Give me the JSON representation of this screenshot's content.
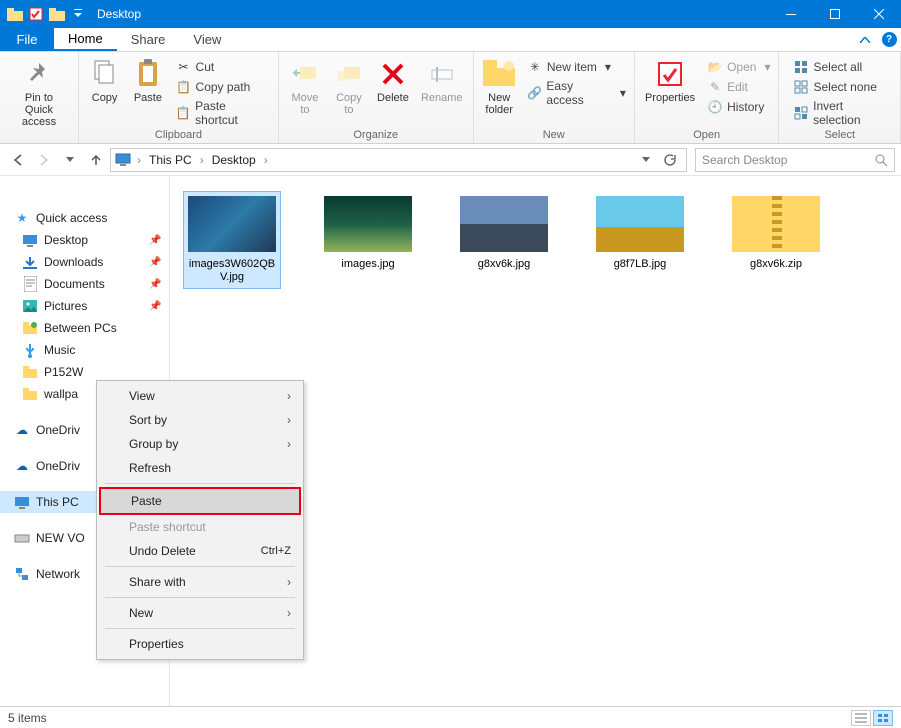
{
  "title": "Desktop",
  "tabs": {
    "file": "File",
    "home": "Home",
    "share": "Share",
    "view": "View"
  },
  "ribbon": {
    "clipboard": {
      "label": "Clipboard",
      "pin": "Pin to Quick\naccess",
      "copy": "Copy",
      "paste": "Paste",
      "cut": "Cut",
      "copypath": "Copy path",
      "pasteshortcut": "Paste shortcut"
    },
    "organize": {
      "label": "Organize",
      "moveto": "Move\nto",
      "copyto": "Copy\nto",
      "delete": "Delete",
      "rename": "Rename"
    },
    "new": {
      "label": "New",
      "newfolder": "New\nfolder",
      "newitem": "New item",
      "easyaccess": "Easy access"
    },
    "open": {
      "label": "Open",
      "properties": "Properties",
      "open": "Open",
      "edit": "Edit",
      "history": "History"
    },
    "select": {
      "label": "Select",
      "selectall": "Select all",
      "selectnone": "Select none",
      "invert": "Invert selection"
    }
  },
  "breadcrumbs": [
    "This PC",
    "Desktop"
  ],
  "search": {
    "placeholder": "Search Desktop"
  },
  "nav": {
    "quickaccess": "Quick access",
    "items1": [
      "Desktop",
      "Downloads",
      "Documents",
      "Pictures",
      "Between PCs",
      "Music",
      "P152W",
      "wallpa"
    ],
    "thispc": "This PC",
    "onedrive": "OneDriv",
    "onedrive2": "OneDriv",
    "newvol": "NEW VO",
    "network": "Network"
  },
  "files": [
    {
      "name": "images3W602QBV.jpg",
      "sel": true,
      "bg": "linear-gradient(135deg,#1a4a7a,#2d7aa8,#1e3856)"
    },
    {
      "name": "images.jpg",
      "bg": "linear-gradient(#0a3a2e,#1d6048,#93b55a)"
    },
    {
      "name": "g8xv6k.jpg",
      "bg": "linear-gradient(#6a8cb8 50%,#3a4a5a 50%)"
    },
    {
      "name": "g8f7LB.jpg",
      "bg": "linear-gradient(#6ac8e8 55%,#c89820 55%)"
    },
    {
      "name": "g8xv6k.zip",
      "zip": true
    }
  ],
  "ctx": {
    "view": "View",
    "sortby": "Sort by",
    "groupby": "Group by",
    "refresh": "Refresh",
    "paste": "Paste",
    "pastesc": "Paste shortcut",
    "undo": "Undo Delete",
    "undokey": "Ctrl+Z",
    "sharewith": "Share with",
    "new": "New",
    "properties": "Properties"
  },
  "status": "5 items"
}
